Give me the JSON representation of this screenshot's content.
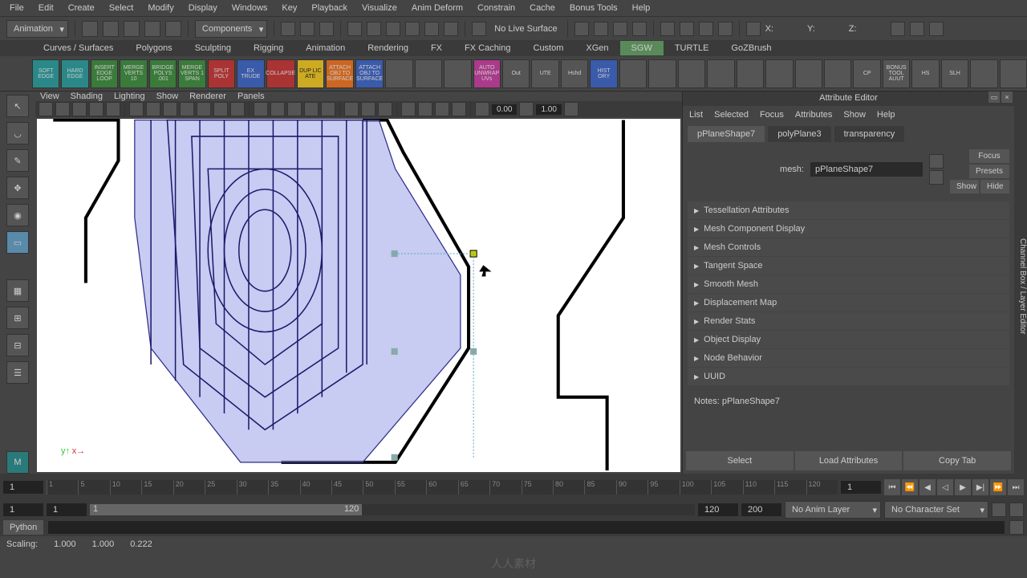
{
  "menubar": [
    "File",
    "Edit",
    "Create",
    "Select",
    "Modify",
    "Display",
    "Windows",
    "Key",
    "Playback",
    "Visualize",
    "Anim Deform",
    "Constrain",
    "Cache",
    "Bonus Tools",
    "Help"
  ],
  "toolbar1": {
    "mode": "Animation",
    "mode2": "Components",
    "live": "No Live Surface",
    "axes": [
      "X:",
      "Y:",
      "Z:"
    ]
  },
  "shelf_tabs": [
    "Curves / Surfaces",
    "Polygons",
    "Sculpting",
    "Rigging",
    "Animation",
    "Rendering",
    "FX",
    "FX Caching",
    "Custom",
    "XGen",
    "SGW",
    "TURTLE",
    "GoZBrush"
  ],
  "active_shelf": "SGW",
  "shelf_buttons": [
    {
      "l": "SOFT EDGE",
      "c": "teal"
    },
    {
      "l": "HARD EDGE",
      "c": "teal"
    },
    {
      "l": "INSERT EDGE LOOP",
      "c": "green"
    },
    {
      "l": "MERGE VERTS 10",
      "c": "green"
    },
    {
      "l": "BRIDGE POLYS .001",
      "c": "green"
    },
    {
      "l": "MERGE VERTS 1 SPAN",
      "c": "green"
    },
    {
      "l": "SPLIT POLY",
      "c": "red"
    },
    {
      "l": "EX TRUDE",
      "c": "blue"
    },
    {
      "l": "COLLAPSE",
      "c": "red"
    },
    {
      "l": "DUP LIC ATE",
      "c": "yellow"
    },
    {
      "l": "ATTACH OBJ TO SURFACE",
      "c": "orange"
    },
    {
      "l": "ATTACH OBJ TO SURFACE",
      "c": "blue"
    },
    {
      "l": "",
      "c": "gray"
    },
    {
      "l": "",
      "c": "gray"
    },
    {
      "l": "",
      "c": "gray"
    },
    {
      "l": "AUTO UNWRAP UVs",
      "c": "mag"
    },
    {
      "l": "Out",
      "c": "gray"
    },
    {
      "l": "UTE",
      "c": "gray"
    },
    {
      "l": "Hshd",
      "c": "gray"
    },
    {
      "l": "HIST ORY",
      "c": "blue"
    },
    {
      "l": "",
      "c": "gray"
    },
    {
      "l": "",
      "c": "gray"
    },
    {
      "l": "",
      "c": "gray"
    },
    {
      "l": "",
      "c": "gray"
    },
    {
      "l": "",
      "c": "gray"
    },
    {
      "l": "",
      "c": "gray"
    },
    {
      "l": "",
      "c": "gray"
    },
    {
      "l": "",
      "c": "gray"
    },
    {
      "l": "CP",
      "c": "gray"
    },
    {
      "l": "BONUS TOOL AUUT",
      "c": "gray"
    },
    {
      "l": "HS",
      "c": "gray"
    },
    {
      "l": "SLH",
      "c": "gray"
    },
    {
      "l": "",
      "c": "gray"
    },
    {
      "l": "",
      "c": "gray"
    }
  ],
  "vp_menu": [
    "View",
    "Shading",
    "Lighting",
    "Show",
    "Renderer",
    "Panels"
  ],
  "vp_vals": {
    "a": "0.00",
    "b": "1.00"
  },
  "attr": {
    "title": "Attribute Editor",
    "menu": [
      "List",
      "Selected",
      "Focus",
      "Attributes",
      "Show",
      "Help"
    ],
    "tabs": [
      "pPlaneShape7",
      "polyPlane3",
      "transparency"
    ],
    "active_tab": "pPlaneShape7",
    "mesh_label": "mesh:",
    "mesh_value": "pPlaneShape7",
    "side": [
      "Focus",
      "Presets",
      "Show",
      "Hide"
    ],
    "sections": [
      "Tessellation Attributes",
      "Mesh Component Display",
      "Mesh Controls",
      "Tangent Space",
      "Smooth Mesh",
      "Displacement Map",
      "Render Stats",
      "Object Display",
      "Node Behavior",
      "UUID"
    ],
    "notes_label": "Notes:",
    "notes_value": "pPlaneShape7",
    "bottom": [
      "Select",
      "Load Attributes",
      "Copy Tab"
    ]
  },
  "right_tab": "Channel Box / Layer Editor",
  "timeline": {
    "start": "1",
    "ticks": [
      "1",
      "5",
      "10",
      "15",
      "20",
      "25",
      "30",
      "35",
      "40",
      "45",
      "50",
      "55",
      "60",
      "65",
      "70",
      "75",
      "80",
      "85",
      "90",
      "95",
      "100",
      "105",
      "110",
      "115",
      "120"
    ],
    "end": "1"
  },
  "range": {
    "a": "1",
    "b": "1",
    "c": "1",
    "d": "120",
    "e": "120",
    "f": "200",
    "layer": "No Anim Layer",
    "charset": "No Character Set"
  },
  "cmd": {
    "label": "Python"
  },
  "status": {
    "label": "Scaling:",
    "v1": "1.000",
    "v2": "1.000",
    "v3": "0.222"
  },
  "watermark": "人人素材"
}
